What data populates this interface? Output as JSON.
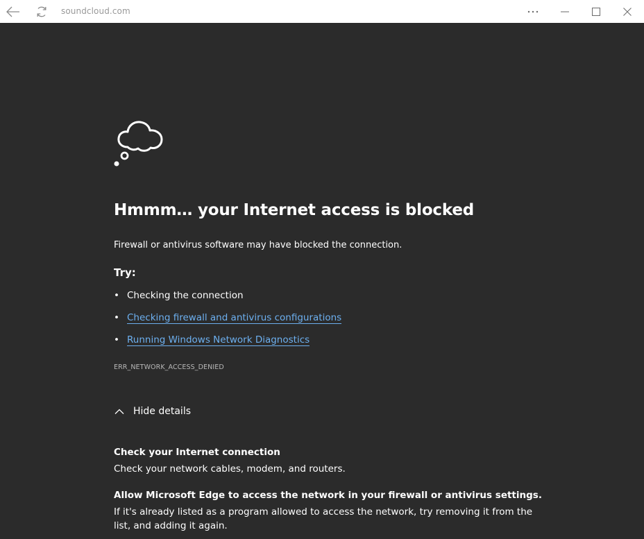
{
  "browser": {
    "url": "soundcloud.com",
    "icons": {
      "back": "back-arrow-icon",
      "refresh": "refresh-icon",
      "more": "more-options-icon",
      "minimize": "minimize-icon",
      "maximize": "maximize-icon",
      "close": "close-icon"
    }
  },
  "error": {
    "icon": "thought-cloud-icon",
    "headline": "Hmmm… your Internet access is blocked",
    "description": "Firewall or antivirus software may have blocked the connection.",
    "try_label": "Try:",
    "suggestions": [
      {
        "text": "Checking the connection",
        "link": false
      },
      {
        "text": "Checking firewall and antivirus configurations",
        "link": true
      },
      {
        "text": "Running Windows Network Diagnostics",
        "link": true
      }
    ],
    "code": "ERR_NETWORK_ACCESS_DENIED",
    "toggle_label": "Hide details",
    "details": [
      {
        "title": "Check your Internet connection",
        "text": "Check your network cables, modem, and routers."
      },
      {
        "title": "Allow Microsoft Edge to access the network in your firewall or antivirus settings.",
        "text": "If it's already listed as a program allowed to access the network, try removing it from the list, and adding it again."
      }
    ]
  },
  "colors": {
    "page_background": "#2b2b2b",
    "link": "#6db0f0",
    "titlebar": "#ffffff"
  }
}
